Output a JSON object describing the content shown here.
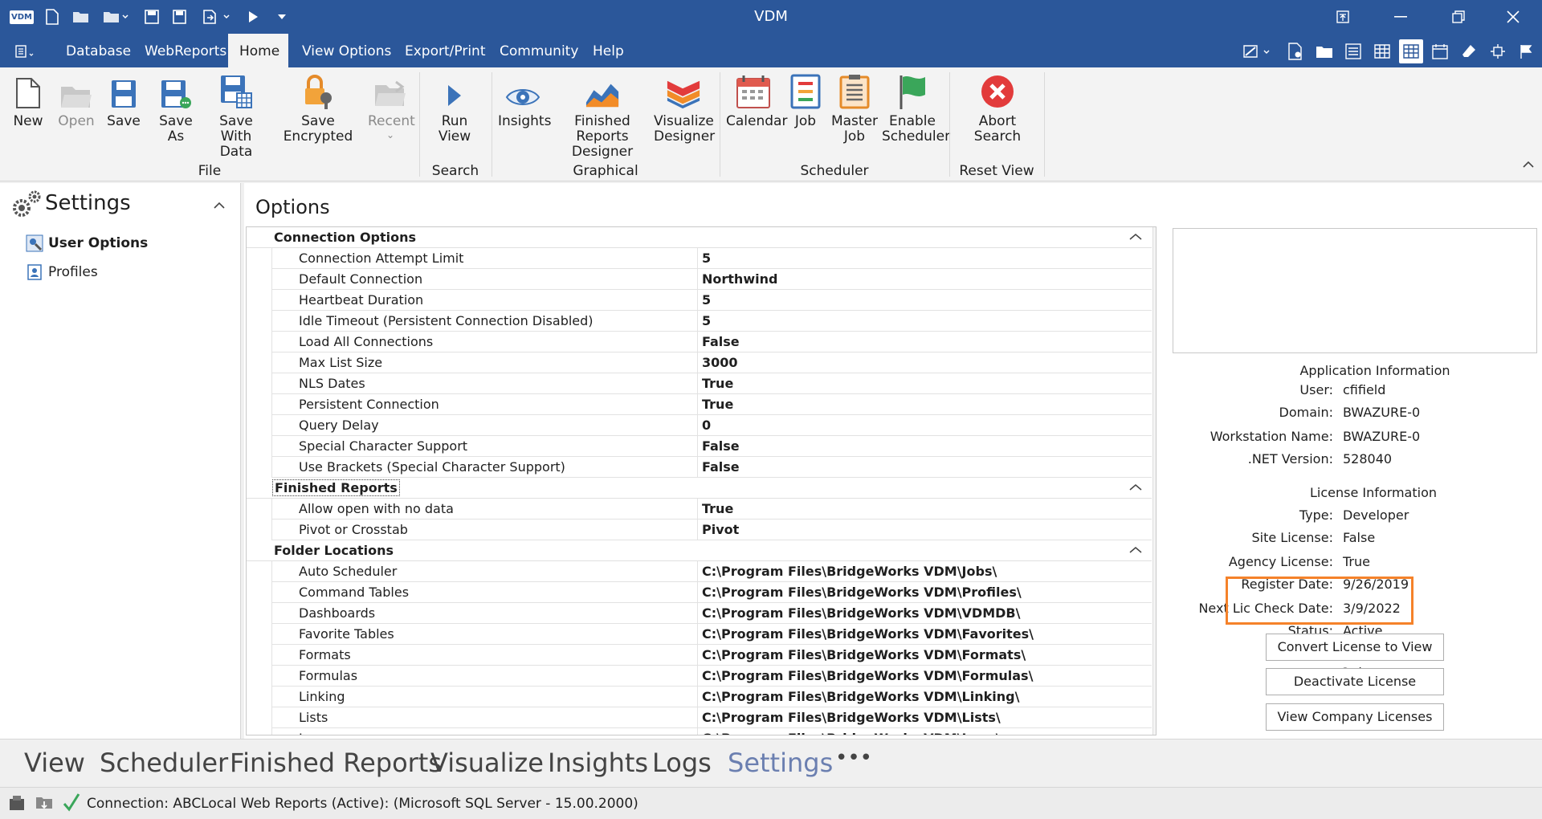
{
  "titlebar": {
    "logo": "VDM",
    "title": "VDM"
  },
  "menu": {
    "tabs": [
      "Database",
      "WebReports",
      "Home",
      "View Options",
      "Export/Print",
      "Community",
      "Help"
    ],
    "active": "Home"
  },
  "ribbon": {
    "buttons": {
      "new": "New",
      "open": "Open",
      "save": "Save",
      "save_as": "Save As",
      "save_with_data_1": "Save With",
      "save_with_data_2": "Data",
      "save_encrypted": "Save Encrypted",
      "recent": "Recent",
      "run_view": "Run View",
      "insights": "Insights",
      "frd_1": "Finished Reports",
      "frd_2": "Designer",
      "viz_1": "Visualize",
      "viz_2": "Designer",
      "calendar": "Calendar",
      "job": "Job",
      "master_1": "Master",
      "master_2": "Job",
      "enable_1": "Enable",
      "enable_2": "Scheduler",
      "abort_1": "Abort",
      "abort_2": "Search"
    },
    "groups": {
      "file": "File",
      "search": "Search",
      "graphical": "Graphical",
      "scheduler": "Scheduler",
      "reset_view": "Reset View"
    }
  },
  "settings_panel": {
    "title": "Settings",
    "items": [
      "User Options",
      "Profiles"
    ]
  },
  "options": {
    "title": "Options",
    "categories": [
      {
        "name": "Connection Options",
        "rows": [
          {
            "name": "Connection Attempt Limit",
            "value": "5"
          },
          {
            "name": "Default Connection",
            "value": "Northwind"
          },
          {
            "name": "Heartbeat Duration",
            "value": "5"
          },
          {
            "name": "Idle Timeout (Persistent Connection Disabled)",
            "value": "5"
          },
          {
            "name": "Load All Connections",
            "value": "False"
          },
          {
            "name": "Max List Size",
            "value": "3000"
          },
          {
            "name": "NLS Dates",
            "value": "True"
          },
          {
            "name": "Persistent Connection",
            "value": "True"
          },
          {
            "name": "Query Delay",
            "value": "0"
          },
          {
            "name": "Special Character Support",
            "value": "False"
          },
          {
            "name": "Use Brackets (Special Character Support)",
            "value": "False"
          }
        ]
      },
      {
        "name": "Finished Reports",
        "rows": [
          {
            "name": "Allow open with no data",
            "value": "True"
          },
          {
            "name": "Pivot or Crosstab",
            "value": "Pivot"
          }
        ]
      },
      {
        "name": "Folder Locations",
        "rows": [
          {
            "name": "Auto Scheduler",
            "value": "C:\\Program Files\\BridgeWorks VDM\\Jobs\\"
          },
          {
            "name": "Command Tables",
            "value": "C:\\Program Files\\BridgeWorks VDM\\Profiles\\"
          },
          {
            "name": "Dashboards",
            "value": "C:\\Program Files\\BridgeWorks VDM\\VDMDB\\"
          },
          {
            "name": "Favorite Tables",
            "value": "C:\\Program Files\\BridgeWorks VDM\\Favorites\\"
          },
          {
            "name": "Formats",
            "value": "C:\\Program Files\\BridgeWorks VDM\\Formats\\"
          },
          {
            "name": "Formulas",
            "value": "C:\\Program Files\\BridgeWorks VDM\\Formulas\\"
          },
          {
            "name": "Linking",
            "value": "C:\\Program Files\\BridgeWorks VDM\\Linking\\"
          },
          {
            "name": "Lists",
            "value": "C:\\Program Files\\BridgeWorks VDM\\Lists\\"
          },
          {
            "name": "Logs",
            "value": "C:\\Program Files\\BridgeWorks VDM\\Logs\\"
          }
        ]
      }
    ]
  },
  "info": {
    "app_heading": "Application Information",
    "app": [
      {
        "label": "User:",
        "value": "cfifield"
      },
      {
        "label": "Domain:",
        "value": "BWAZURE-0"
      },
      {
        "label": "Workstation Name:",
        "value": "BWAZURE-0"
      },
      {
        "label": ".NET Version:",
        "value": "528040"
      }
    ],
    "license_heading": "License Information",
    "license": [
      {
        "label": "Type:",
        "value": "Developer"
      },
      {
        "label": "Site License:",
        "value": "False"
      },
      {
        "label": "Agency License:",
        "value": "True"
      },
      {
        "label": "Register Date:",
        "value": "9/26/2019"
      },
      {
        "label": "Next Lic Check Date:",
        "value": "3/9/2022"
      },
      {
        "label": "Status:",
        "value": "Active"
      }
    ],
    "buttons": [
      "Convert License to View Only",
      "Deactivate License",
      "View Company Licenses"
    ]
  },
  "bottom_nav": {
    "items": [
      "View",
      "Scheduler",
      "Finished Reports",
      "Visualize",
      "Insights",
      "Logs",
      "Settings"
    ],
    "active": "Settings",
    "more": "•••"
  },
  "status_bar": {
    "text": "Connection: ABCLocal Web Reports (Active): (Microsoft SQL Server - 15.00.2000)"
  },
  "colors": {
    "titlebar": "#2b579a",
    "ribbon": "#f3f3f3",
    "highlight": "#f5822a",
    "nav_active": "#6b7fb0"
  }
}
